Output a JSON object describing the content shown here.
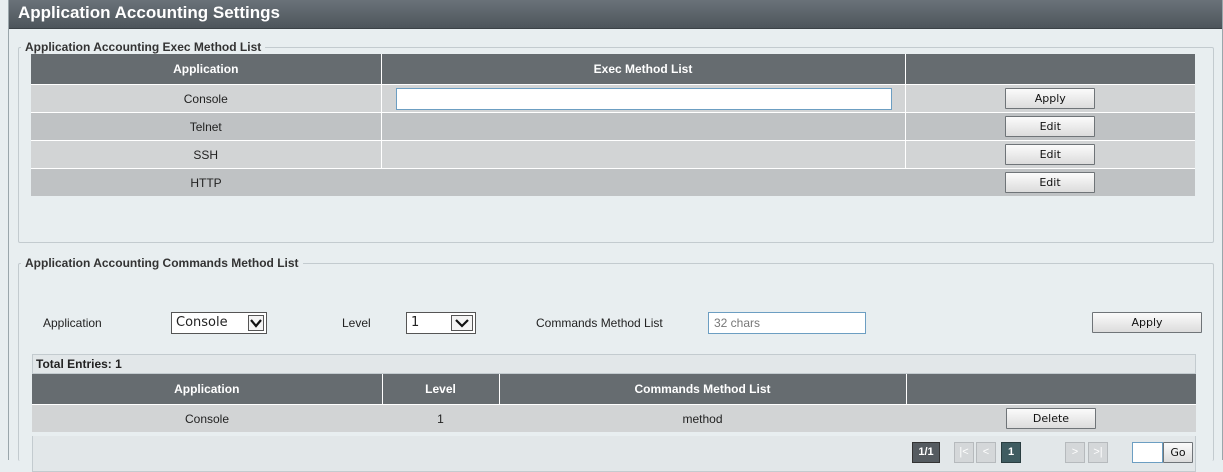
{
  "page": {
    "title": "Application Accounting Settings"
  },
  "exec_section": {
    "legend": "Application Accounting Exec Method List",
    "headers": [
      "Application",
      "Exec Method List",
      ""
    ],
    "rows": [
      {
        "application": "Console",
        "method": "",
        "button": "Apply",
        "editing": true
      },
      {
        "application": "Telnet",
        "method": "",
        "button": "Edit"
      },
      {
        "application": "SSH",
        "method": "",
        "button": "Edit"
      },
      {
        "application": "HTTP",
        "method": "",
        "button": "Edit"
      }
    ]
  },
  "cmd_section": {
    "legend": "Application Accounting Commands Method List",
    "application_label": "Application",
    "application_value": "Console",
    "level_label": "Level",
    "level_value": "1",
    "method_label": "Commands Method List",
    "method_placeholder": "32 chars",
    "apply_label": "Apply",
    "total_entries": "Total Entries: 1",
    "headers": [
      "Application",
      "Level",
      "Commands Method List",
      ""
    ],
    "rows": [
      {
        "application": "Console",
        "level": "1",
        "method": "method",
        "button": "Delete"
      }
    ],
    "pager": {
      "page_count": "1/1",
      "first": "|<",
      "prev": "<",
      "current": "1",
      "next": ">",
      "last": ">|",
      "go_label": "Go",
      "page_input": ""
    }
  }
}
